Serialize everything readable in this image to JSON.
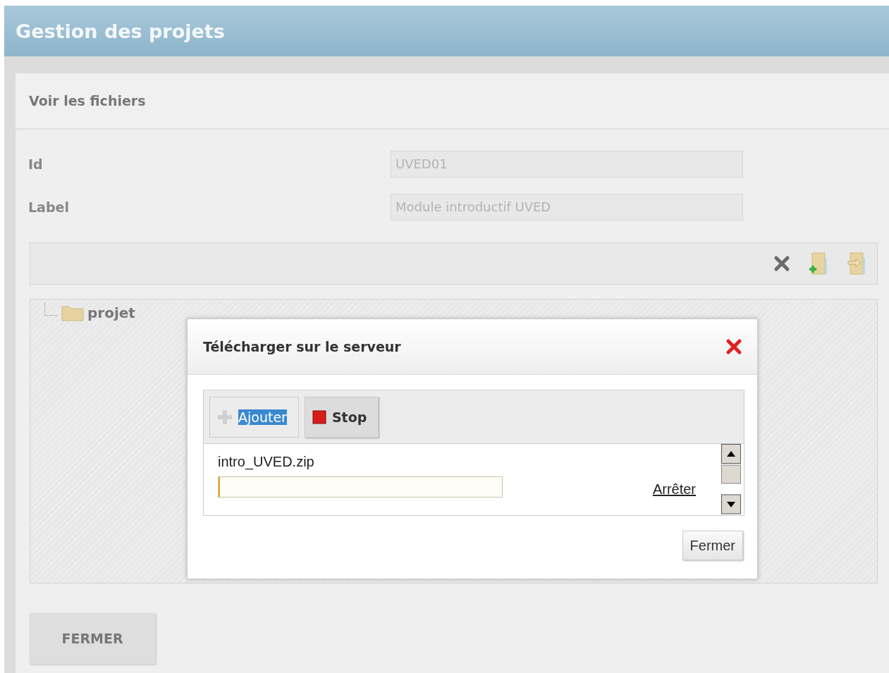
{
  "header": {
    "title": "Gestion des projets"
  },
  "panel": {
    "title": "Voir les fichiers"
  },
  "fields": [
    {
      "label": "Id",
      "value": "UVED01",
      "disabled": true
    },
    {
      "label": "Label",
      "value": "Module introductif UVED",
      "disabled": true
    }
  ],
  "tree": {
    "items": [
      {
        "label": "projet",
        "expanded": false
      }
    ]
  },
  "dialog": {
    "title": "Télécharger sur le serveur",
    "buttons": [
      {
        "label": "Ajouter",
        "kind": "add",
        "text_selected": true
      },
      {
        "label": "Stop",
        "kind": "stop",
        "text_selected": false
      }
    ],
    "files": [
      {
        "name": "intro_UVED.zip",
        "level": 0.005,
        "action": "Arrêter"
      }
    ],
    "close_label": "Fermer"
  },
  "footer_button": "FERMER"
}
